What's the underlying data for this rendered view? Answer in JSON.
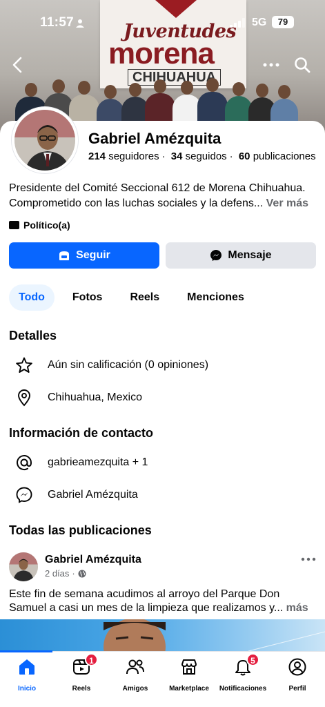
{
  "status_bar": {
    "time": "11:57",
    "network": "5G",
    "battery": "79"
  },
  "cover": {
    "banner_line1": "Juventudes",
    "banner_line2": "morena",
    "banner_line3": "CHIHUAHUA"
  },
  "profile": {
    "name": "Gabriel Amézquita",
    "followers_count": "214",
    "followers_label": "seguidores",
    "following_count": "34",
    "following_label": "seguidos",
    "posts_count": "60",
    "posts_label": "publicaciones",
    "bio": "Presidente del Comité Seccional 612 de Morena Chihuahua. Comprometido con las luchas sociales y la defens...",
    "bio_more": "Ver más",
    "category": "Político(a)"
  },
  "actions": {
    "follow_label": "Seguir",
    "message_label": "Mensaje"
  },
  "tabs": [
    {
      "label": "Todo",
      "active": true
    },
    {
      "label": "Fotos",
      "active": false
    },
    {
      "label": "Reels",
      "active": false
    },
    {
      "label": "Menciones",
      "active": false
    }
  ],
  "details": {
    "title": "Detalles",
    "rating": "Aún sin calificación (0 opiniones)",
    "location": "Chihuahua, Mexico"
  },
  "contact": {
    "title": "Información de contacto",
    "instagram": "gabrieamezquita + 1",
    "messenger": "Gabriel Amézquita"
  },
  "posts": {
    "title": "Todas las publicaciones",
    "author": "Gabriel Amézquita",
    "time": "2 días",
    "text": "Este fin de semana acudimos al arroyo del Parque Don Samuel a casi un mes de la limpieza que realizamos y...",
    "more": "más"
  },
  "bottom_nav": [
    {
      "label": "Inicio",
      "active": true,
      "badge": ""
    },
    {
      "label": "Reels",
      "active": false,
      "badge": "1"
    },
    {
      "label": "Amigos",
      "active": false,
      "badge": ""
    },
    {
      "label": "Marketplace",
      "active": false,
      "badge": ""
    },
    {
      "label": "Notificaciones",
      "active": false,
      "badge": "5"
    },
    {
      "label": "Perfil",
      "active": false,
      "badge": ""
    }
  ],
  "colors": {
    "accent": "#0866ff",
    "badge": "#e41e3f",
    "secondary_text": "#65676b",
    "button_gray": "#e4e6eb"
  }
}
